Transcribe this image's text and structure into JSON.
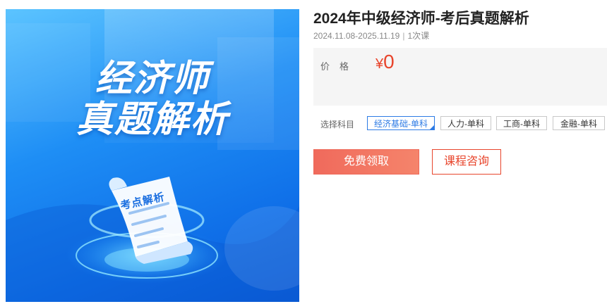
{
  "cover": {
    "title_line1": "经济师",
    "title_line2": "真题解析",
    "paper_label": "考点解析"
  },
  "course": {
    "title": "2024年中级经济师-考后真题解析",
    "date_range": "2024.11.08-2025.11.19",
    "lesson_count": "1次课"
  },
  "price": {
    "label": "价格",
    "currency": "¥",
    "value": "0",
    "color": "#e8452c"
  },
  "subjects": {
    "label": "选择科目",
    "items": [
      "经济基础-单科",
      "人力-单科",
      "工商-单科",
      "金融-单科"
    ],
    "selected": "经济基础-单科"
  },
  "actions": {
    "free_label": "免费领取",
    "consult_label": "课程咨询"
  }
}
